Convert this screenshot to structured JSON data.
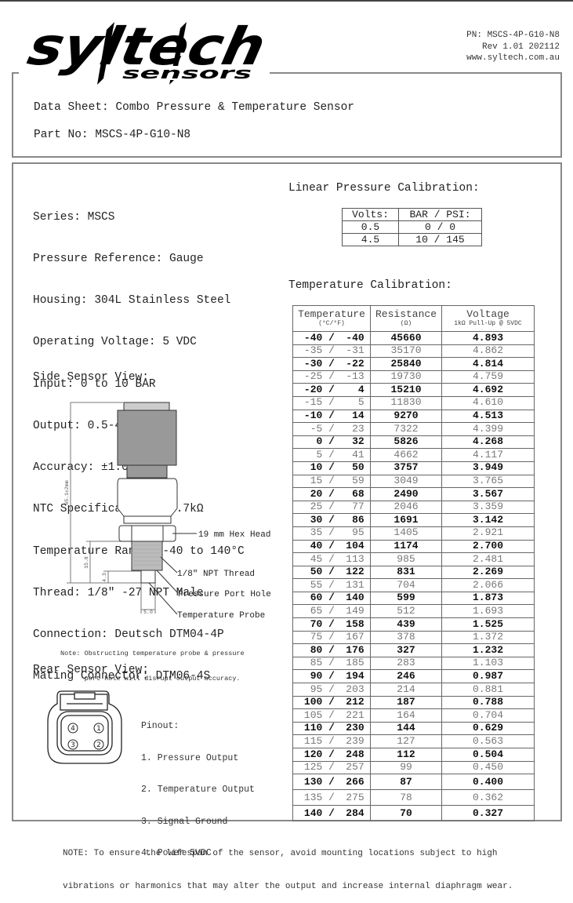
{
  "header": {
    "logo_text": "syltech",
    "logo_subtext": "sensors",
    "pn": "PN: MSCS-4P-G10-N8",
    "rev": "Rev 1.01 202112",
    "website": "www.syltech.com.au"
  },
  "title_box": {
    "title": "Data Sheet: Combo Pressure & Temperature Sensor",
    "part_no": "Part No: MSCS-4P-G10-N8"
  },
  "specs": [
    "Series: MSCS",
    "Pressure Reference: Gauge",
    "Housing: 304L Stainless Steel",
    "Operating Voltage: 5 VDC",
    "Input: 0 to 10 BAR",
    "Output: 0.5-4.5 VDC",
    "Accuracy: ±1.0% FS",
    "NTC Specifications: 2.7kΩ",
    "Temperature Range: -40 to 140°C",
    "Thread: 1/8\" -27 NPT Male",
    "Connection: Deutsch DTM04-4P",
    "Mating Connector: DTM06-4S"
  ],
  "side_view": {
    "heading": "Side Sensor View:",
    "dim_total": "65.1±2mm",
    "dim_thread": "15.8",
    "dim_probe": "4.3",
    "dim_probe_width": "5.0",
    "label_hex": "19 mm Hex Head",
    "label_thread": "1/8\" NPT Thread",
    "label_port": "Pressure Port Hole",
    "label_probe": "Temperature Probe",
    "note_line1": "Note: Obstructing temperature probe & pressure",
    "note_line2": "      port hole will disrupt output accuracy."
  },
  "rear_view": {
    "heading": "Rear Sensor View:",
    "pins": [
      "4",
      "1",
      "3",
      "2"
    ],
    "pinout_title": "Pinout:",
    "pinout": [
      "1. Pressure Output",
      "2. Temperature Output",
      "3. Signal Ground",
      "4. Power 5VDC"
    ]
  },
  "linear_calibration": {
    "heading": "Linear Pressure Calibration:",
    "headers": [
      "Volts:",
      "BAR / PSI:"
    ],
    "rows": [
      [
        "0.5",
        "0 / 0"
      ],
      [
        "4.5",
        "10 / 145"
      ]
    ]
  },
  "temperature_calibration": {
    "heading": "Temperature Calibration:",
    "headers": [
      {
        "main": "Temperature",
        "sub": "(°C/°F)"
      },
      {
        "main": "Resistance",
        "sub": "(Ω)"
      },
      {
        "main": "Voltage",
        "sub": "1kΩ Pull-Up @ 5VDC"
      }
    ],
    "rows": [
      {
        "c": "-40",
        "f": "-40",
        "r": "45660",
        "v": "4.893"
      },
      {
        "c": "-35",
        "f": "-31",
        "r": "35170",
        "v": "4.862"
      },
      {
        "c": "-30",
        "f": "-22",
        "r": "25840",
        "v": "4.814"
      },
      {
        "c": "-25",
        "f": "-13",
        "r": "19730",
        "v": "4.759"
      },
      {
        "c": "-20",
        "f": "4",
        "r": "15210",
        "v": "4.692"
      },
      {
        "c": "-15",
        "f": "5",
        "r": "11830",
        "v": "4.610"
      },
      {
        "c": "-10",
        "f": "14",
        "r": "9270",
        "v": "4.513"
      },
      {
        "c": "-5",
        "f": "23",
        "r": "7322",
        "v": "4.399"
      },
      {
        "c": "0",
        "f": "32",
        "r": "5826",
        "v": "4.268"
      },
      {
        "c": "5",
        "f": "41",
        "r": "4662",
        "v": "4.117"
      },
      {
        "c": "10",
        "f": "50",
        "r": "3757",
        "v": "3.949"
      },
      {
        "c": "15",
        "f": "59",
        "r": "3049",
        "v": "3.765"
      },
      {
        "c": "20",
        "f": "68",
        "r": "2490",
        "v": "3.567"
      },
      {
        "c": "25",
        "f": "77",
        "r": "2046",
        "v": "3.359"
      },
      {
        "c": "30",
        "f": "86",
        "r": "1691",
        "v": "3.142"
      },
      {
        "c": "35",
        "f": "95",
        "r": "1405",
        "v": "2.921"
      },
      {
        "c": "40",
        "f": "104",
        "r": "1174",
        "v": "2.700"
      },
      {
        "c": "45",
        "f": "113",
        "r": "985",
        "v": "2.481"
      },
      {
        "c": "50",
        "f": "122",
        "r": "831",
        "v": "2.269"
      },
      {
        "c": "55",
        "f": "131",
        "r": "704",
        "v": "2.066"
      },
      {
        "c": "60",
        "f": "140",
        "r": "599",
        "v": "1.873"
      },
      {
        "c": "65",
        "f": "149",
        "r": "512",
        "v": "1.693"
      },
      {
        "c": "70",
        "f": "158",
        "r": "439",
        "v": "1.525"
      },
      {
        "c": "75",
        "f": "167",
        "r": "378",
        "v": "1.372"
      },
      {
        "c": "80",
        "f": "176",
        "r": "327",
        "v": "1.232"
      },
      {
        "c": "85",
        "f": "185",
        "r": "283",
        "v": "1.103"
      },
      {
        "c": "90",
        "f": "194",
        "r": "246",
        "v": "0.987"
      },
      {
        "c": "95",
        "f": "203",
        "r": "214",
        "v": "0.881"
      },
      {
        "c": "100",
        "f": "212",
        "r": "187",
        "v": "0.788"
      },
      {
        "c": "105",
        "f": "221",
        "r": "164",
        "v": "0.704"
      },
      {
        "c": "110",
        "f": "230",
        "r": "144",
        "v": "0.629"
      },
      {
        "c": "115",
        "f": "239",
        "r": "127",
        "v": "0.563"
      },
      {
        "c": "120",
        "f": "248",
        "r": "112",
        "v": "0.504"
      },
      {
        "c": "125",
        "f": "257",
        "r": "99",
        "v": "0.450"
      },
      {
        "c": "130",
        "f": "266",
        "r": "87",
        "v": "0.400"
      },
      {
        "c": "135",
        "f": "275",
        "r": "78",
        "v": "0.362"
      },
      {
        "c": "140",
        "f": "284",
        "r": "70",
        "v": "0.327"
      }
    ]
  },
  "footer": {
    "line1": "NOTE: To ensure the lifespan of the sensor, avoid mounting locations subject to high",
    "line2": "vibrations or harmonics that may alter the output and increase internal diaphragm wear."
  }
}
